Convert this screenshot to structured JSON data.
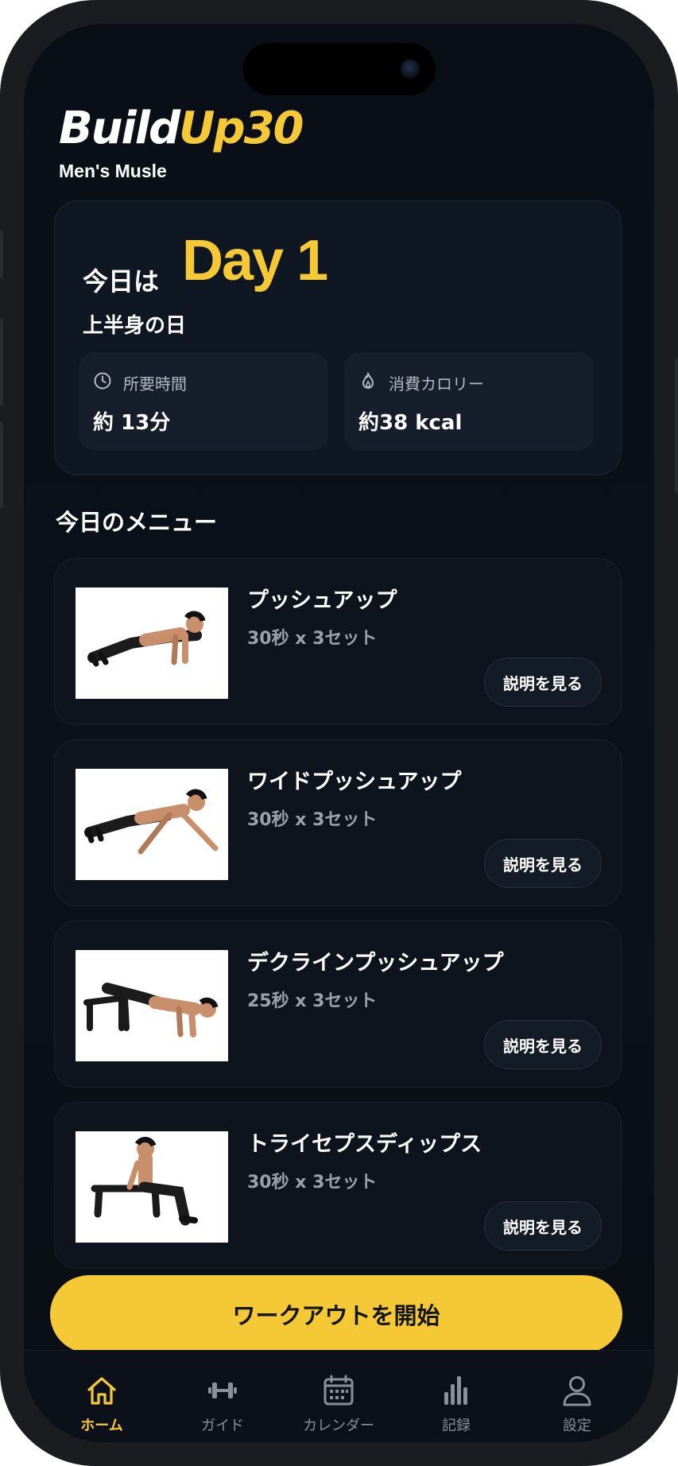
{
  "app": {
    "logo_part1": "Build",
    "logo_part2": "Up30",
    "tagline": "Men's Musle"
  },
  "hero": {
    "today_prefix": "今日は",
    "day_label": "Day 1",
    "focus": "上半身の日",
    "stats": [
      {
        "icon": "clock-icon",
        "label": "所要時間",
        "value": "約 13分"
      },
      {
        "icon": "flame-icon",
        "label": "消費カロリー",
        "value": "約38 kcal"
      }
    ]
  },
  "menu": {
    "title": "今日のメニュー",
    "detail_label": "説明を見る",
    "items": [
      {
        "name": "プッシュアップ",
        "reps": "30秒 x 3セット",
        "image": "pushup-photo"
      },
      {
        "name": "ワイドプッシュアップ",
        "reps": "30秒 x 3セット",
        "image": "wide-pushup-photo"
      },
      {
        "name": "デクラインプッシュアップ",
        "reps": "25秒 x 3セット",
        "image": "decline-pushup-photo"
      },
      {
        "name": "トライセプスディップス",
        "reps": "30秒 x 3セット",
        "image": "triceps-dips-photo"
      }
    ]
  },
  "actions": {
    "start_label": "ワークアウトを開始"
  },
  "tabs": [
    {
      "label": "ホーム",
      "icon": "home-icon",
      "active": true
    },
    {
      "label": "ガイド",
      "icon": "dumbbell-icon",
      "active": false
    },
    {
      "label": "カレンダー",
      "icon": "calendar-icon",
      "active": false
    },
    {
      "label": "記録",
      "icon": "bar-chart-icon",
      "active": false
    },
    {
      "label": "設定",
      "icon": "user-icon",
      "active": false
    }
  ],
  "colors": {
    "accent": "#f5c935",
    "background": "#0a0f17",
    "card": "#0f1722",
    "inactive_tab": "#8a909a"
  }
}
